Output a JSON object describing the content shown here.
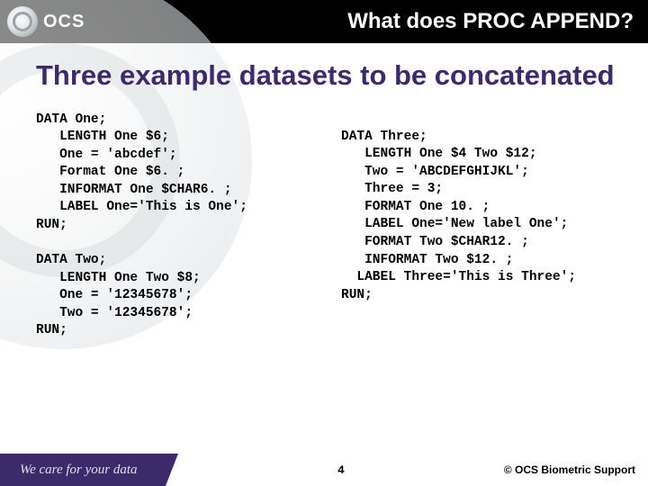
{
  "header": {
    "logo_text": "OCS",
    "title": "What does PROC APPEND?"
  },
  "content": {
    "section_title": "Three example datasets to be concatenated",
    "code_left": "DATA One;\n   LENGTH One $6;\n   One = 'abcdef';\n   Format One $6. ;\n   INFORMAT One $CHAR6. ;\n   LABEL One='This is One';\nRUN;\n\nDATA Two;\n   LENGTH One Two $8;\n   One = '12345678';\n   Two = '12345678';\nRUN;",
    "code_right": "DATA Three;\n   LENGTH One $4 Two $12;\n   Two = 'ABCDEFGHIJKL';\n   Three = 3;\n   FORMAT One 10. ;\n   LABEL One='New label One';\n   FORMAT Two $CHAR12. ;\n   INFORMAT Two $12. ;\n  LABEL Three='This is Three';\nRUN;"
  },
  "footer": {
    "tagline": "We care for your data",
    "page_number": "4",
    "copyright": "© OCS Biometric Support"
  }
}
